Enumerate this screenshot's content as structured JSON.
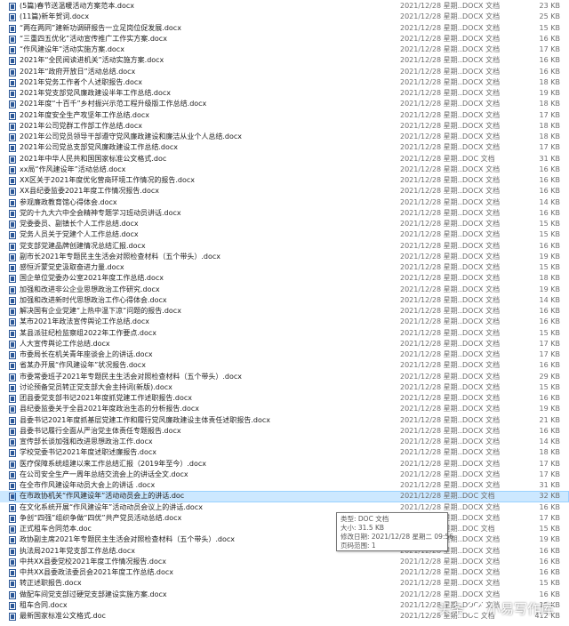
{
  "files": [
    {
      "name": "(5篇)春节送温暖活动方案范本.docx",
      "date": "2021/12/28 星期...",
      "type": "DOCX 文档",
      "size": "23 KB"
    },
    {
      "name": "(11篇)新年贺词.docx",
      "date": "2021/12/28 星期...",
      "type": "DOCX 文档",
      "size": "25 KB"
    },
    {
      "name": "“两在两同”建新功调研报告一立足岗位促发展.docx",
      "date": "2021/12/28 星期...",
      "type": "DOCX 文档",
      "size": "15 KB"
    },
    {
      "name": "“三重四五优化”活动宣传推广工作实方案.docx",
      "date": "2021/12/28 星期...",
      "type": "DOCX 文档",
      "size": "16 KB"
    },
    {
      "name": "“作风建设年”活动实施方案.docx",
      "date": "2021/12/28 星期...",
      "type": "DOCX 文档",
      "size": "17 KB"
    },
    {
      "name": "2021年“全民阅读进机关”活动实施方案.docx",
      "date": "2021/12/28 星期...",
      "type": "DOCX 文档",
      "size": "16 KB"
    },
    {
      "name": "2021年“政府开放日”活动总结.docx",
      "date": "2021/12/28 星期...",
      "type": "DOCX 文档",
      "size": "16 KB"
    },
    {
      "name": "2021年党务工作者个人述职报告.docx",
      "date": "2021/12/28 星期...",
      "type": "DOCX 文档",
      "size": "18 KB"
    },
    {
      "name": "2021年党支部党风廉政建设半年工作总结.docx",
      "date": "2021/12/28 星期...",
      "type": "DOCX 文档",
      "size": "19 KB"
    },
    {
      "name": "2021年度“十百千”乡村振兴示范工程升级版工作总结.docx",
      "date": "2021/12/28 星期...",
      "type": "DOCX 文档",
      "size": "18 KB"
    },
    {
      "name": "2021年度安全生产攻坚年工作总结.docx",
      "date": "2021/12/28 星期...",
      "type": "DOCX 文档",
      "size": "17 KB"
    },
    {
      "name": "2021年公司党群工作部工作总结.docx",
      "date": "2021/12/28 星期...",
      "type": "DOCX 文档",
      "size": "18 KB"
    },
    {
      "name": "2021年公司党员领导干部遵守党风廉政建设和廉洁从业个人总结.docx",
      "date": "2021/12/28 星期...",
      "type": "DOCX 文档",
      "size": "18 KB"
    },
    {
      "name": "2021年公司党总支部党风廉政建设工作总结.docx",
      "date": "2021/12/28 星期...",
      "type": "DOCX 文档",
      "size": "17 KB"
    },
    {
      "name": "2021年中华人民共和国国家标准公文格式.doc",
      "date": "2021/12/28 星期...",
      "type": "DOC 文档",
      "size": "31 KB"
    },
    {
      "name": "xx局“作风建设年”活动总结.docx",
      "date": "2021/12/28 星期...",
      "type": "DOCX 文档",
      "size": "16 KB"
    },
    {
      "name": "XX区关于2021年度优化营商环境工作情况的报告.docx",
      "date": "2021/12/28 星期...",
      "type": "DOCX 文档",
      "size": "16 KB"
    },
    {
      "name": "XX县纪委监委2021年度工作情况报告.docx",
      "date": "2021/12/28 星期...",
      "type": "DOCX 文档",
      "size": "16 KB"
    },
    {
      "name": "参观廉政教育馆心得体会.docx",
      "date": "2021/12/28 星期...",
      "type": "DOCX 文档",
      "size": "14 KB"
    },
    {
      "name": "党的十九大六中全会精神专题学习班动员讲话.docx",
      "date": "2021/12/28 星期...",
      "type": "DOCX 文档",
      "size": "16 KB"
    },
    {
      "name": "党委委员、副镇长个人工作总结.docx",
      "date": "2021/12/28 星期...",
      "type": "DOCX 文档",
      "size": "15 KB"
    },
    {
      "name": "党务人员关于党建个人工作总结.docx",
      "date": "2021/12/28 星期...",
      "type": "DOCX 文档",
      "size": "15 KB"
    },
    {
      "name": "党支部党建品牌创建情况总结汇报.docx",
      "date": "2021/12/28 星期...",
      "type": "DOCX 文档",
      "size": "16 KB"
    },
    {
      "name": "副市长2021年专题民主生活会对照检查材料（五个带头）.docx",
      "date": "2021/12/28 星期...",
      "type": "DOCX 文档",
      "size": "19 KB"
    },
    {
      "name": "感恒沂蒙党史汲取奋进力量.docx",
      "date": "2021/12/28 星期...",
      "type": "DOCX 文档",
      "size": "15 KB"
    },
    {
      "name": "国企单位党委办公室2021年度工作总结.docx",
      "date": "2021/12/28 星期...",
      "type": "DOCX 文档",
      "size": "18 KB"
    },
    {
      "name": "加强和改进非公企业思想政治工作研究.docx",
      "date": "2021/12/28 星期...",
      "type": "DOCX 文档",
      "size": "19 KB"
    },
    {
      "name": "加强和改进新时代思想政治工作心得体会.docx",
      "date": "2021/12/28 星期...",
      "type": "DOCX 文档",
      "size": "14 KB"
    },
    {
      "name": "解决国有企业党建“上热中温下凉”问题的报告.docx",
      "date": "2021/12/28 星期...",
      "type": "DOCX 文档",
      "size": "16 KB"
    },
    {
      "name": "某市2021年政法宣传舆论工作总结.docx",
      "date": "2021/12/28 星期...",
      "type": "DOCX 文档",
      "size": "16 KB"
    },
    {
      "name": "某县派驻纪检监察组2022年工作要点.docx",
      "date": "2021/12/28 星期...",
      "type": "DOCX 文档",
      "size": "15 KB"
    },
    {
      "name": "人大宣传舆论工作总结.docx",
      "date": "2021/12/28 星期...",
      "type": "DOCX 文档",
      "size": "17 KB"
    },
    {
      "name": "市委局长在机关青年座谈会上的讲话.docx",
      "date": "2021/12/28 星期...",
      "type": "DOCX 文档",
      "size": "17 KB"
    },
    {
      "name": "省某办开展“作风建设年”状况报告.docx",
      "date": "2021/12/28 星期...",
      "type": "DOCX 文档",
      "size": "16 KB"
    },
    {
      "name": "市委常委班子2021年专题民主生活会对照检查材料（五个带头）.docx",
      "date": "2021/12/28 星期...",
      "type": "DOCX 文档",
      "size": "29 KB"
    },
    {
      "name": "讨论预备党员转正党支部大会主持词(新版).docx",
      "date": "2021/12/28 星期...",
      "type": "DOCX 文档",
      "size": "15 KB"
    },
    {
      "name": "团县委党支部书记2021年度抓党建工作述职报告.docx",
      "date": "2021/12/28 星期...",
      "type": "DOCX 文档",
      "size": "16 KB"
    },
    {
      "name": "县纪委监委关于全县2021年度政治生态的分析报告.docx",
      "date": "2021/12/28 星期...",
      "type": "DOCX 文档",
      "size": "19 KB"
    },
    {
      "name": "县委书记2021年度抓基层党建工作和履行党风廉政建设主体责任述职报告.docx",
      "date": "2021/12/28 星期...",
      "type": "DOCX 文档",
      "size": "21 KB"
    },
    {
      "name": "县委书记履行全面从严治党主体责任专题报告.docx",
      "date": "2021/12/28 星期...",
      "type": "DOCX 文档",
      "size": "16 KB"
    },
    {
      "name": "宣传部长谈加强和改进思想政治工作.docx",
      "date": "2021/12/28 星期...",
      "type": "DOCX 文档",
      "size": "14 KB"
    },
    {
      "name": "学校党委书记2021年度述职述廉报告.docx",
      "date": "2021/12/28 星期...",
      "type": "DOCX 文档",
      "size": "18 KB"
    },
    {
      "name": "医疗保障系统组建以来工作总结汇报（2019年至今）.docx",
      "date": "2021/12/28 星期...",
      "type": "DOCX 文档",
      "size": "17 KB"
    },
    {
      "name": "在公司安全生产一周年总结交流会上的讲话全文.docx",
      "date": "2021/12/28 星期...",
      "type": "DOCX 文档",
      "size": "17 KB"
    },
    {
      "name": "在全市作风建设年动员大会上的讲话 .docx",
      "date": "2021/12/28 星期...",
      "type": "DOCX 文档",
      "size": "31 KB"
    },
    {
      "name": "在市政协机关“作风建设年”活动动员会上的讲话.doc",
      "date": "2021/12/28 星期...",
      "type": "DOC 文档",
      "size": "32 KB"
    },
    {
      "name": "在文化系统开展“作风建设年”活动动员会议上的讲话.docx",
      "date": "2021/12/28 星期...",
      "type": "DOCX 文档",
      "size": "16 KB"
    },
    {
      "name": "争创“四强”组织争做“四优”共产党员活动总结.docx",
      "date": "2021/12/28 星期...",
      "type": "DOCX 文档",
      "size": "17 KB"
    },
    {
      "name": "正式租车合同范本.doc",
      "date": "2021/12/28 星期...",
      "type": "DOC 文档",
      "size": "15 KB"
    },
    {
      "name": "政协副主席2021年专题民主生活会对照检查材料（五个带头）.docx",
      "date": "2021/12/28 星期...",
      "type": "DOCX 文档",
      "size": "19 KB"
    },
    {
      "name": "执法局2021年党支部工作总结.docx",
      "date": "2021/12/28 星期...",
      "type": "DOCX 文档",
      "size": "16 KB"
    },
    {
      "name": "中共XX县委党校2021年度工作情况报告.docx",
      "date": "2021/12/28 星期...",
      "type": "DOCX 文档",
      "size": "16 KB"
    },
    {
      "name": "中共XX县委政法委员会2021年度工作总结.docx",
      "date": "2021/12/28 星期...",
      "type": "DOCX 文档",
      "size": "16 KB"
    },
    {
      "name": "转正述职报告.docx",
      "date": "2021/12/28 星期...",
      "type": "DOCX 文档",
      "size": "15 KB"
    },
    {
      "name": "做配车间党支部过硬党支部建设实施方案.docx",
      "date": "2021/12/28 星期...",
      "type": "DOCX 文档",
      "size": "16 KB"
    },
    {
      "name": "租车合同.docx",
      "date": "2021/12/28 星期...",
      "type": "DOCX 文档",
      "size": "15 KB"
    },
    {
      "name": "最新国家标准公文格式.doc",
      "date": "2021/12/28 星期...",
      "type": "DOC 文档",
      "size": "412 KB"
    }
  ],
  "selected_index": 45,
  "tooltip": {
    "type": "类型: DOC 文档",
    "size": "大小: 31.5 KB",
    "modified": "修改日期: 2021/12/28 星期二 09:56",
    "pages": "页码范围: 1"
  },
  "watermark": {
    "text_left": "头条",
    "text_right": "小易写作库",
    "icon": "at-icon"
  },
  "colors": {
    "selection": "#cce8ff",
    "icon_blue": "#2b5797",
    "meta_text": "#6d6d6d"
  }
}
